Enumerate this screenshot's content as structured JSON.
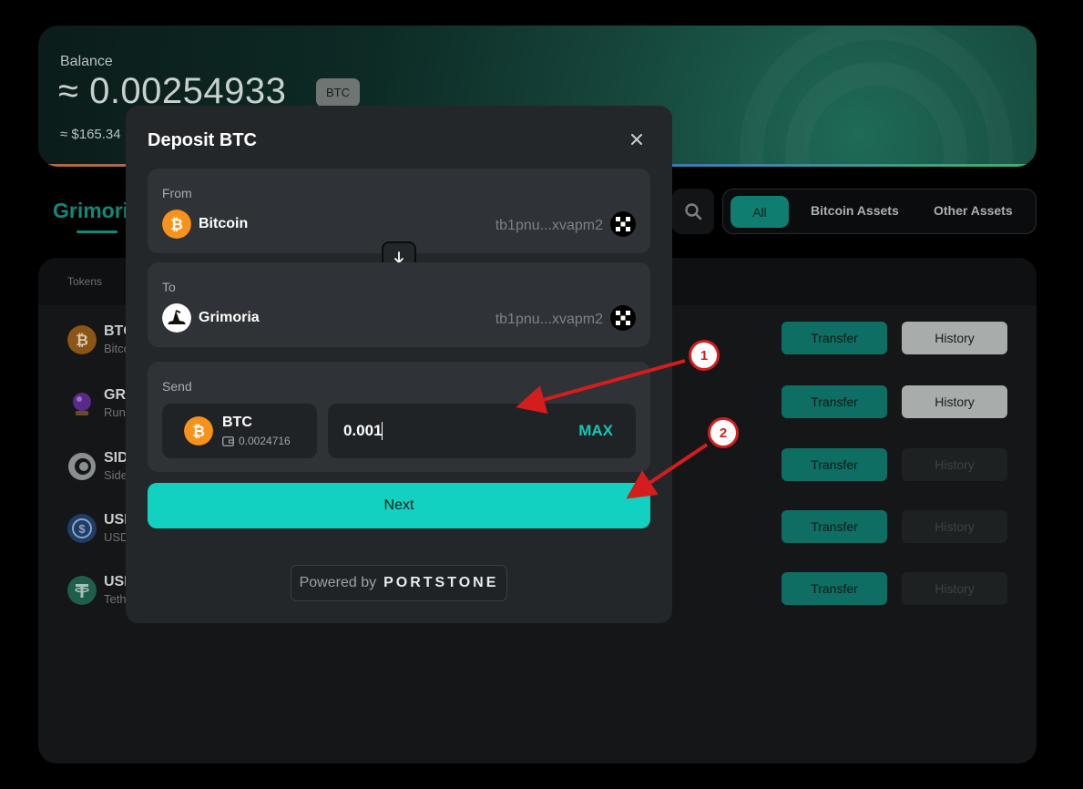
{
  "balance": {
    "label": "Balance",
    "value": "≈ 0.00254933",
    "unit": "BTC",
    "usd": "≈ $165.34"
  },
  "main_tab": "Grimoria",
  "filters": [
    "All",
    "Bitcoin Assets",
    "Other Assets"
  ],
  "tokens_header": "Tokens",
  "tokens": [
    {
      "symbol": "BTC",
      "name": "Bitcoin",
      "transfer": "Transfer",
      "history": "History",
      "history_enabled": true,
      "icon": "bitcoin-icon"
    },
    {
      "symbol": "GRI",
      "name": "Runes",
      "transfer": "Transfer",
      "history": "History",
      "history_enabled": true,
      "icon": "crystal-ball-icon"
    },
    {
      "symbol": "SID",
      "name": "Side",
      "transfer": "Transfer",
      "history": "History",
      "history_enabled": false,
      "icon": "side-icon"
    },
    {
      "symbol": "USI",
      "name": "USD",
      "transfer": "Transfer",
      "history": "History",
      "history_enabled": false,
      "icon": "usdc-icon"
    },
    {
      "symbol": "USI",
      "name": "Teth",
      "transfer": "Transfer",
      "history": "History",
      "history_enabled": false,
      "icon": "tether-icon"
    }
  ],
  "modal": {
    "title": "Deposit BTC",
    "from": {
      "label": "From",
      "chain": "Bitcoin",
      "address": "tb1pnu...xvapm2"
    },
    "to": {
      "label": "To",
      "chain": "Grimoria",
      "address": "tb1pnu...xvapm2"
    },
    "send": {
      "label": "Send",
      "asset": "BTC",
      "asset_balance": "0.0024716",
      "amount": "0.001",
      "max_label": "MAX"
    },
    "next_label": "Next",
    "powered_by": "Powered by",
    "brand": "PORTSTONE"
  },
  "annotations": [
    "1",
    "2"
  ],
  "colors": {
    "accent": "#12d1c0",
    "bitcoin": "#f7931a",
    "annotation": "#d51d1d"
  }
}
